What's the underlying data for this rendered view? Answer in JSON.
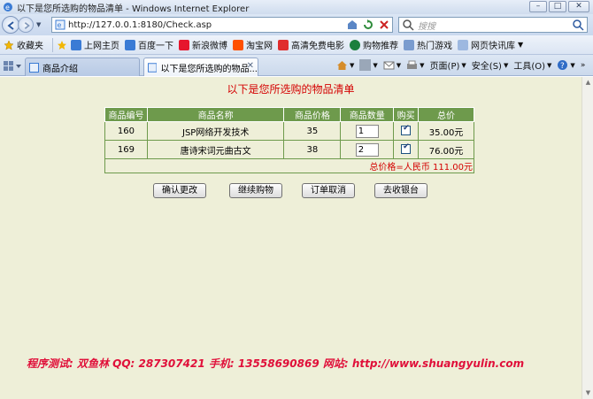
{
  "window": {
    "title": "以下是您所选购的物品清单 - Windows Internet Explorer",
    "controls": [
      "–",
      "□",
      "✕"
    ]
  },
  "address_bar": {
    "url": "http://127.0.0.1:8180/Check.asp",
    "search_placeholder": "搜搜"
  },
  "favorites_bar": {
    "label": "收藏夹",
    "items": [
      "上网主页",
      "百度一下",
      "新浪微博",
      "淘宝网",
      "高清免费电影",
      "购物推荐",
      "热门游戏",
      "网页快讯库"
    ]
  },
  "tabs": [
    {
      "label": "商品介绍",
      "active": false
    },
    {
      "label": "以下是您所选购的物品...",
      "active": true
    }
  ],
  "command_bar": {
    "page": "页面(P)",
    "safety": "安全(S)",
    "tools": "工具(O)"
  },
  "page": {
    "heading": "以下是您所选购的物品清单",
    "table": {
      "headers": [
        "商品编号",
        "商品名称",
        "商品价格",
        "商品数量",
        "购买",
        "总价"
      ],
      "rows": [
        {
          "id": "160",
          "name": "JSP网络开发技术",
          "price": "35",
          "qty": "1",
          "checked": true,
          "total": "35.00元"
        },
        {
          "id": "169",
          "name": "唐诗宋词元曲古文",
          "price": "38",
          "qty": "2",
          "checked": true,
          "total": "76.00元"
        }
      ],
      "summary": "总价格=人民币  111.00元"
    },
    "buttons": {
      "confirm": "确认更改",
      "continue": "继续购物",
      "cancel": "订单取消",
      "checkout": "去收银台"
    },
    "footer": "程序测试: 双鱼林   QQ: 287307421   手机: 13558690869   网站: http://www.shuangyulin.com"
  },
  "colors": {
    "page_bg": "#eeefd8",
    "table_header": "#6e9a4c",
    "accent_red": "#d40000",
    "footer_red": "#e0103a"
  }
}
